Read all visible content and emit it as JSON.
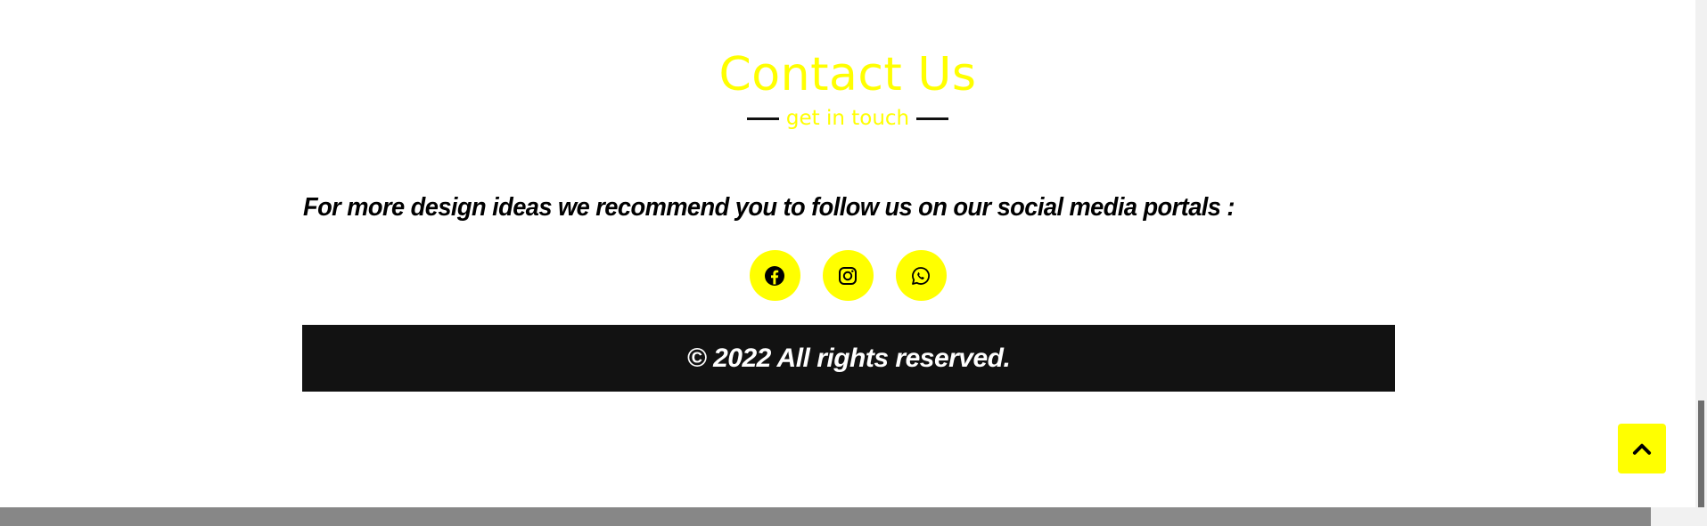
{
  "contact": {
    "title": "Contact Us",
    "subtitle": "get in touch"
  },
  "follow": {
    "text": "For more design ideas we recommend you to follow us on our social media portals :"
  },
  "social": [
    {
      "icon": "facebook-icon"
    },
    {
      "icon": "instagram-icon"
    },
    {
      "icon": "whatsapp-icon"
    }
  ],
  "footer": {
    "copyright": "© 2022 All rights reserved."
  },
  "scroll_top": {
    "icon": "chevron-up-icon"
  },
  "colors": {
    "accent": "#ffff00",
    "footer_bg": "#121212",
    "text": "#000000"
  }
}
